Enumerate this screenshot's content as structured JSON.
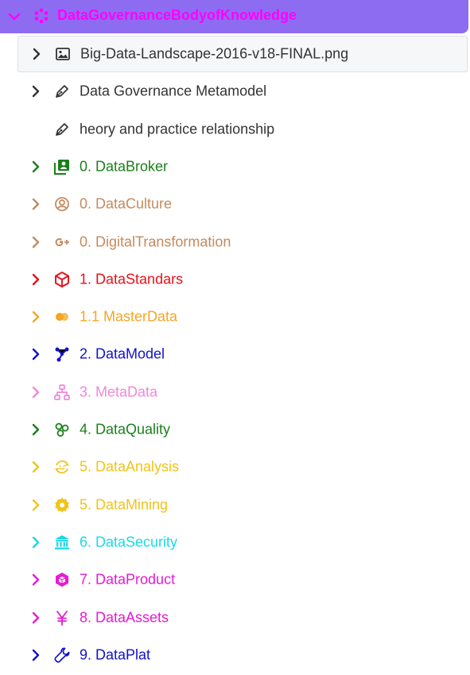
{
  "header": {
    "title": "DataGovernanceBodyofKnowledge",
    "color": "#ff00ff",
    "background": "#8e6cf2"
  },
  "items": [
    {
      "label": "Big-Data-Landscape-2016-v18-FINAL.png",
      "color": "#333333",
      "icon": "image-icon",
      "has_chevron": true
    },
    {
      "label": "Data Governance Metamodel",
      "color": "#333333",
      "icon": "pen-icon",
      "has_chevron": true
    },
    {
      "label": "heory and practice relationship",
      "color": "#333333",
      "icon": "pen-icon",
      "has_chevron": false
    },
    {
      "label": "0. DataBroker",
      "color": "#1a7f1a",
      "icon": "contacts-icon",
      "has_chevron": true
    },
    {
      "label": "0. DataCulture",
      "color": "#c58a5e",
      "icon": "user-circle-icon",
      "has_chevron": true
    },
    {
      "label": "0. DigitalTransformation",
      "color": "#c58a5e",
      "icon": "google-plus-icon",
      "has_chevron": true
    },
    {
      "label": "1. DataStandars",
      "color": "#e8101a",
      "icon": "unity-icon",
      "has_chevron": true
    },
    {
      "label": "1.1 MasterData",
      "color": "#f5a623",
      "icon": "mastercard-icon",
      "has_chevron": true
    },
    {
      "label": "2. DataModel",
      "color": "#1111cc",
      "icon": "nodes-icon",
      "has_chevron": true
    },
    {
      "label": "3. MetaData",
      "color": "#ee88dd",
      "icon": "sitemap-icon",
      "has_chevron": true
    },
    {
      "label": "4. DataQuality",
      "color": "#1a7f1a",
      "icon": "molecule-icon",
      "has_chevron": true
    },
    {
      "label": "5. DataAnalysis",
      "color": "#f2c31a",
      "icon": "sync-face-icon",
      "has_chevron": true
    },
    {
      "label": "5. DataMining",
      "color": "#f2c31a",
      "icon": "gear-icon",
      "has_chevron": true
    },
    {
      "label": "6. DataSecurity",
      "color": "#19d9e8",
      "icon": "bank-icon",
      "has_chevron": true
    },
    {
      "label": "7. DataProduct",
      "color": "#e81ad2",
      "icon": "hexagon-box-icon",
      "has_chevron": true
    },
    {
      "label": "8. DataAssets",
      "color": "#e81ad2",
      "icon": "yen-icon",
      "has_chevron": true
    },
    {
      "label": "9. DataPlat",
      "color": "#1111cc",
      "icon": "wrench-icon",
      "has_chevron": true
    }
  ]
}
